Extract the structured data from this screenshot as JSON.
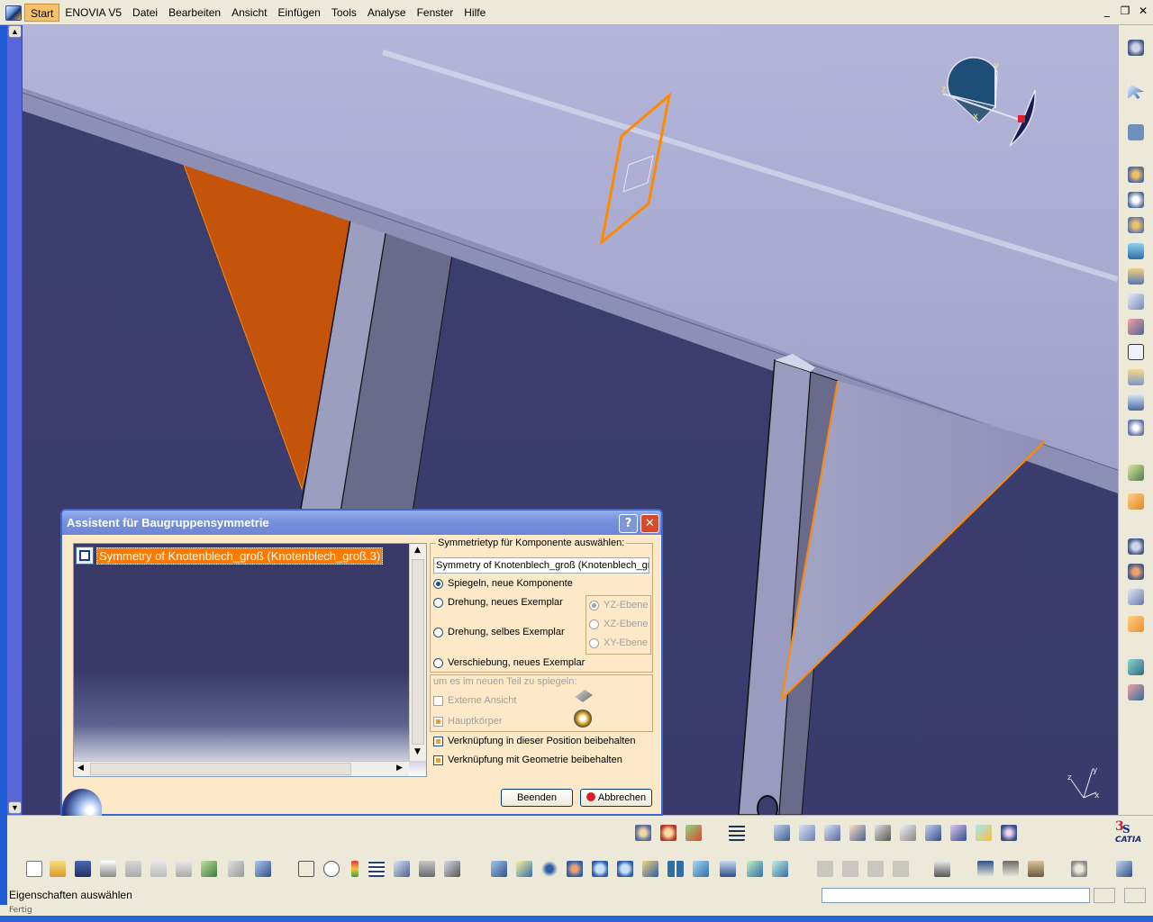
{
  "menubar": {
    "items": [
      "Start",
      "ENOVIA V5",
      "Datei",
      "Bearbeiten",
      "Ansicht",
      "Einfügen",
      "Tools",
      "Analyse",
      "Fenster",
      "Hilfe"
    ]
  },
  "window_controls": [
    "_",
    "❐",
    "✕"
  ],
  "compass": {
    "x": "x",
    "y": "y",
    "z": "z"
  },
  "dialog": {
    "title": "Assistent für Baugruppensymmetrie",
    "help_label": "?",
    "close_label": "✕",
    "tree_item": "Symmetry of Knotenblech_groß (Knotenblech_groß.3)",
    "symmetry_group_label": "Symmetrietyp für Komponente auswählen:",
    "symmetry_field_value": "Symmetry of Knotenblech_groß (Knotenblech_groß.3)",
    "options": {
      "mirror_new": "Spiegeln, neue Komponente",
      "rotate_new": "Drehung, neues Exemplar",
      "rotate_same": "Drehung, selbes Exemplar",
      "translate_new": "Verschiebung, neues Exemplar"
    },
    "selected_option": "Spiegeln, neue Komponente",
    "planes": [
      "YZ-Ebene",
      "XZ-Ebene",
      "XY-Ebene"
    ],
    "mirror_group_label": "um es im neuen Teil zu spiegeln:",
    "external_view": "Externe Ansicht",
    "main_body": "Hauptkörper",
    "keep_position_link": "Verknüpfung in dieser Position beibehalten",
    "keep_geometry_link": "Verknüpfung mit Geometrie beibehalten",
    "finish_button": "Beenden",
    "cancel_button": "Abbrechen"
  },
  "status": {
    "text": "Eigenschaften auswählen",
    "footer": "Fertig"
  },
  "brand": "CATIA",
  "colors": {
    "viewport_bg": "#3c3d6e",
    "beam": "#a9abcf",
    "highlight": "#ff7a00",
    "dialog_bg": "#fde9c8",
    "titlebar": "#7592dc"
  }
}
